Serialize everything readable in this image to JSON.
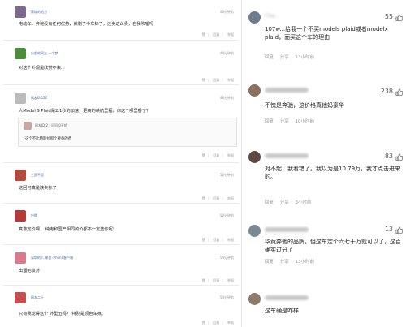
{
  "left_panel": {
    "actions": {
      "like": "赞",
      "reply": "回复",
      "report": "举报"
    },
    "comments": [
      {
        "user": "英雄的地方",
        "time": "48分钟前",
        "text": "电动车，奔驰没有任何优势，就剩了个车标了，还卖这么贵，自我吹嘘吗",
        "avatar_color": "#7d6a8f"
      },
      {
        "user": "以前的网友 一个梦",
        "time": "48分钟前",
        "text": "对这个外观是欣赏不来...",
        "avatar_color": "#4c8c3d"
      },
      {
        "user": "网友6ID52",
        "time": "48分钟前",
        "text": "人Model S Plaid是2.1秒的加速，更高的续航里程，你这个哪里香了？",
        "avatar_color": "#bbbbbb",
        "reply": {
          "user": "网友ID 2 | 问问 0天前",
          "text": "这个不比特斯拉那个要香的香",
          "avatar_color": "#c9a7a0"
        }
      },
      {
        "user": "三国不是",
        "time": "50分钟前",
        "text": "这回可真是跌卖标了",
        "avatar_color": "#b34a3e"
      },
      {
        "user": "白酸",
        "time": "50分钟前",
        "text": "真敢定价啊， 纯电和国产相同的价都不一定选你呢！",
        "avatar_color": "#b33b3b"
      },
      {
        "user": "深圳的人 来自 iPhone客户端",
        "time": "54分钟前",
        "text": "出溜吧妆对",
        "avatar_color": "#d97a8c"
      },
      {
        "user": "网友二十",
        "time": "54分钟前",
        "text": "只有我觉得这个 外型丑吗？ 特别是顶色车身。",
        "avatar_color": "#c44f4f"
      }
    ]
  },
  "right_panel": {
    "meta": {
      "reply": "回复",
      "share": "分享"
    },
    "comments": [
      {
        "name": "Clay...",
        "likes": "55",
        "text": "107w...给我一个不买models plaid或者modelx plaid，而买这个车的理由",
        "time": "13小时前",
        "avatar_color": "#6d7c8c"
      },
      {
        "name": "",
        "likes": "238",
        "text": "不愧是奔驰，这价格真他妈豪华",
        "time": "10小时前",
        "avatar_color": "#8a6f60"
      },
      {
        "name": "",
        "likes": "83",
        "text": "对不起，我看错了。我以为是10.79万，我才点击进来的。",
        "time": "3小时前",
        "avatar_color": "#5f4a43"
      },
      {
        "name": "",
        "likes": "13",
        "text": "华竟奔驰的品牌，但这车定个六七十万就可以了，这百确实过分了",
        "time": "13小时前",
        "avatar_color": "#7a8a95"
      },
      {
        "name": "",
        "likes": "",
        "text": "这车确是咋样",
        "time": "",
        "avatar_color": "#8d7b6a"
      }
    ]
  },
  "colors": {
    "username_blue": "#4a6ea9",
    "meta_gray": "#999999",
    "divider": "#ececec"
  }
}
